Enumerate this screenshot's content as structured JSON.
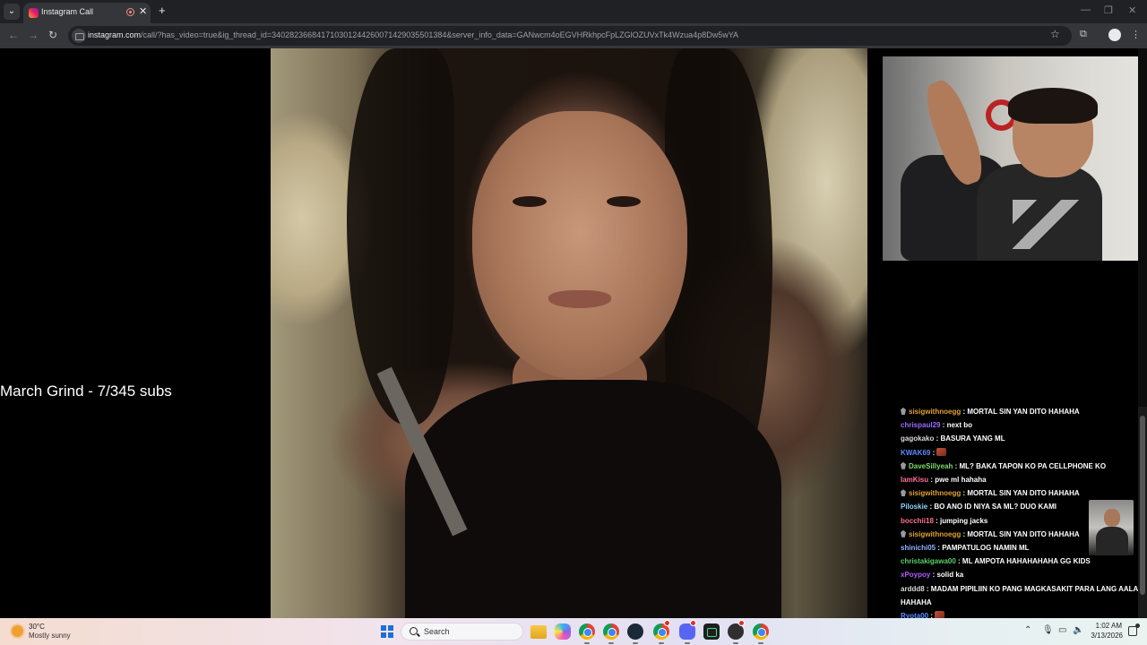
{
  "browser": {
    "tab_title": "Instagram Call",
    "url_host": "instagram.com",
    "url_path": "/call/?has_video=true&ig_thread_id=340282366841710301244260071429035501384&server_info_data=GANwcm4oEGVHRkhpcFpLZGlOZUVxTk4Wzua4p8Dw5wYA"
  },
  "page": {
    "overlay_text": "March Grind - 7/345 subs"
  },
  "chat": {
    "messages": [
      {
        "user": "sisigwithnoegg",
        "text": "MORTAL SIN YAN DITO HAHAHA",
        "color": "#e0a030",
        "badge": true
      },
      {
        "user": "chrispaul29",
        "text": "next bo",
        "color": "#9b6bff",
        "badge": false
      },
      {
        "user": "gagokako",
        "text": "BASURA YANG ML",
        "color": "#d9d9d9",
        "badge": false
      },
      {
        "user": "KWAK69",
        "text": "",
        "color": "#5b8dff",
        "badge": false,
        "emote": true
      },
      {
        "user": "DaveSillyeah",
        "text": "ML? BAKA TAPON KO PA CELLPHONE KO",
        "color": "#7fdc6a",
        "badge": true
      },
      {
        "user": "IamKisu",
        "text": "pwe ml hahaha",
        "color": "#ff6fa0",
        "badge": false
      },
      {
        "user": "sisigwithnoegg",
        "text": "MORTAL SIN YAN DITO HAHAHA",
        "color": "#e0a030",
        "badge": true
      },
      {
        "user": "Piloskie",
        "text": "BO ANO ID NIYA SA ML? DUO KAMI",
        "color": "#8fd3ff",
        "badge": false
      },
      {
        "user": "bocchii18",
        "text": "jumping jacks",
        "color": "#ff6f8f",
        "badge": false
      },
      {
        "user": "sisigwithnoegg",
        "text": "MORTAL SIN YAN DITO HAHAHA",
        "color": "#e0a030",
        "badge": true
      },
      {
        "user": "shinichi05",
        "text": "PAMPATULOG NAMIN ML",
        "color": "#8fb3ff",
        "badge": false
      },
      {
        "user": "christakigawa00",
        "text": "ML AMPOTA HAHAHAHAHA GG KIDS",
        "color": "#58d06a",
        "badge": false
      },
      {
        "user": "xPoypoy",
        "text": "solid ka",
        "color": "#b05cff",
        "badge": false
      },
      {
        "user": "arddd8",
        "text": "MADAM PIPILIIN KO PANG MAGKASAKIT PARA LANG AALAGAAN MO AKO",
        "color": "#d9d9d9",
        "badge": false
      },
      {
        "user": "",
        "text": "HAHAHA",
        "color": "#ffffff",
        "badge": false
      },
      {
        "user": "Ryota00",
        "text": "",
        "color": "#5b8dff",
        "badge": false,
        "emote": true
      }
    ]
  },
  "taskbar": {
    "weather_temp": "30°C",
    "weather_desc": "Mostly sunny",
    "search_label": "Search",
    "time": "1:02 AM",
    "date": "3/13/2026",
    "apps": [
      "file-explorer",
      "copilot",
      "chrome",
      "chrome",
      "steam",
      "chrome",
      "discord",
      "terminal",
      "obs",
      "chrome"
    ]
  }
}
